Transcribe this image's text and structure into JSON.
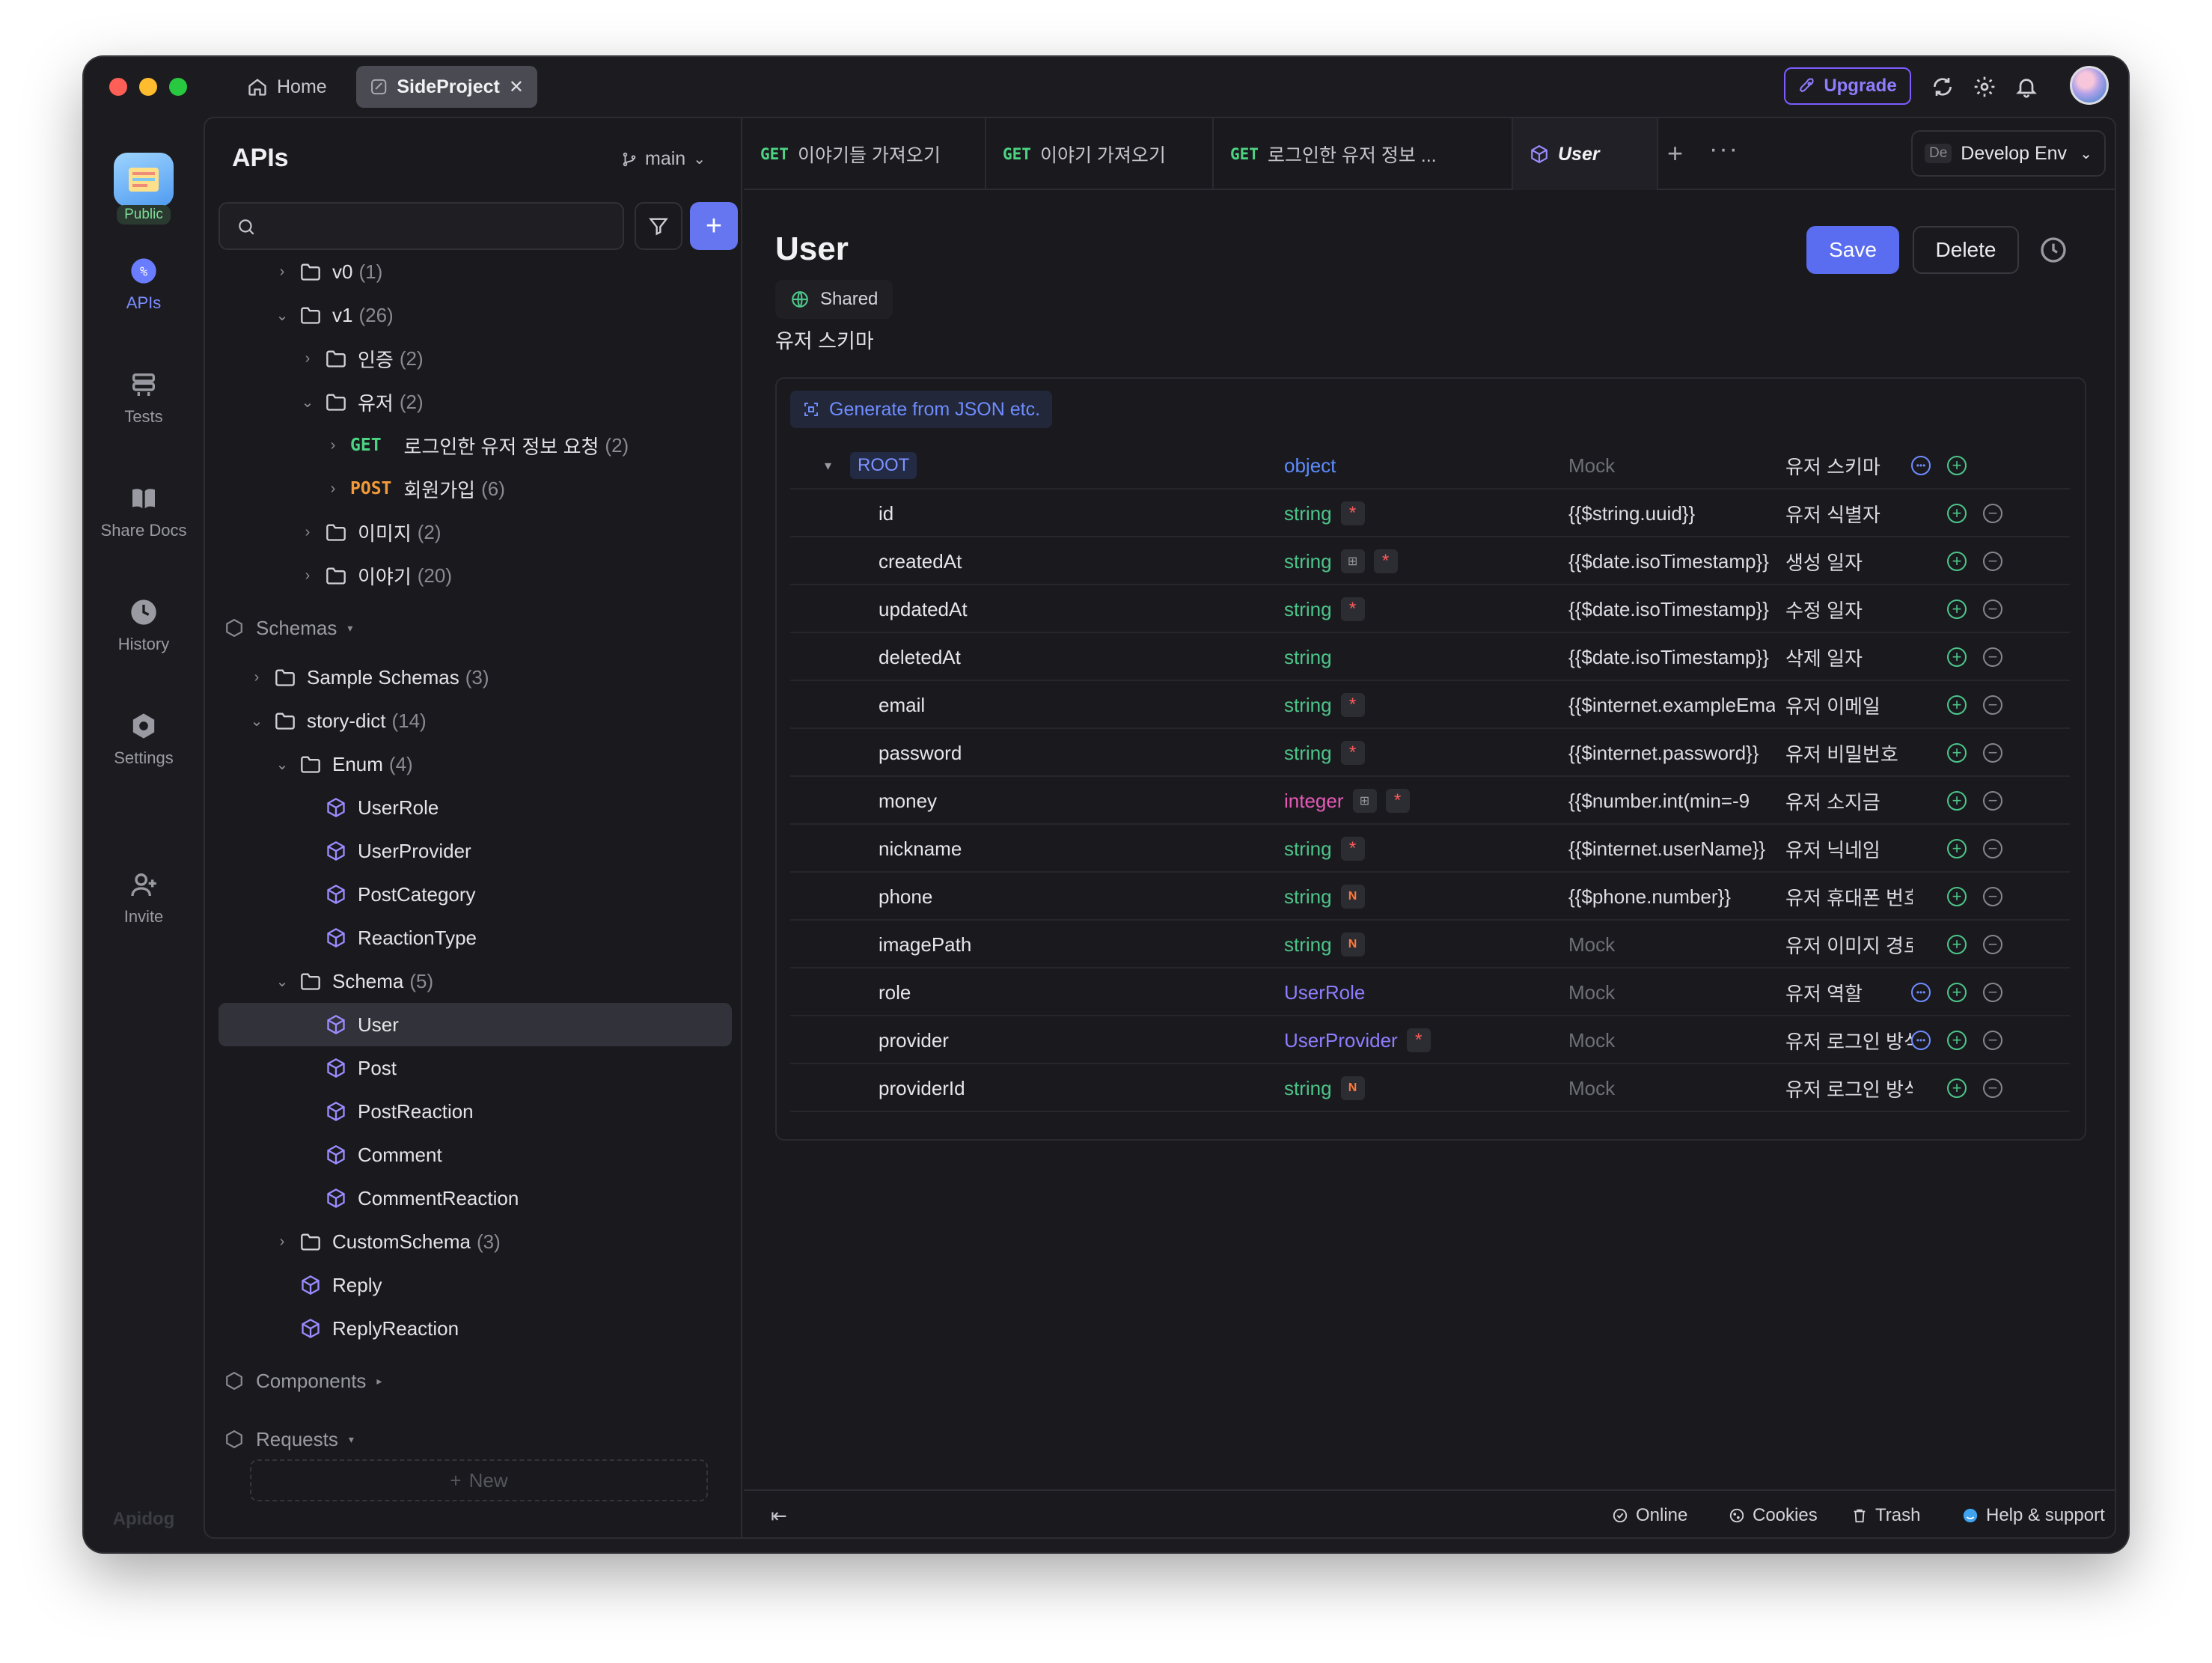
{
  "titlebar": {
    "home_label": "Home",
    "project_tab_label": "SideProject",
    "upgrade_label": "Upgrade"
  },
  "rail": {
    "public_badge": "Public",
    "items": [
      {
        "label": "APIs",
        "icon": "apis-icon",
        "active": true
      },
      {
        "label": "Tests",
        "icon": "tests-icon",
        "active": false
      },
      {
        "label": "Share Docs",
        "icon": "share-docs-icon",
        "active": false
      },
      {
        "label": "History",
        "icon": "history-icon",
        "active": false
      },
      {
        "label": "Settings",
        "icon": "settings-icon",
        "active": false
      },
      {
        "label": "Invite",
        "icon": "invite-icon",
        "active": false
      }
    ],
    "brand": "Apidog"
  },
  "sidebar": {
    "title": "APIs",
    "branch": "main",
    "tree": [
      {
        "kind": "folder",
        "label": "v0",
        "count": "(1)",
        "depth": 2,
        "chevron": "›"
      },
      {
        "kind": "folder",
        "label": "v1",
        "count": "(26)",
        "depth": 2,
        "chevron": "⌄"
      },
      {
        "kind": "folder",
        "label": "인증",
        "count": "(2)",
        "depth": 3,
        "chevron": "›"
      },
      {
        "kind": "folder",
        "label": "유저",
        "count": "(2)",
        "depth": 3,
        "chevron": "⌄"
      },
      {
        "kind": "endpoint",
        "method": "GET",
        "label": "로그인한 유저 정보 요청",
        "count": "(2)",
        "depth": 4,
        "chevron": "›"
      },
      {
        "kind": "endpoint",
        "method": "POST",
        "label": "회원가입",
        "count": "(6)",
        "depth": 4,
        "chevron": "›"
      },
      {
        "kind": "folder",
        "label": "이미지",
        "count": "(2)",
        "depth": 3,
        "chevron": "›"
      },
      {
        "kind": "folder",
        "label": "이야기",
        "count": "(20)",
        "depth": 3,
        "chevron": "›"
      },
      {
        "kind": "section",
        "label": "Schemas",
        "depth": 0
      },
      {
        "kind": "folder",
        "label": "Sample Schemas",
        "count": "(3)",
        "depth": 1,
        "chevron": "›"
      },
      {
        "kind": "folder",
        "label": "story-dict",
        "count": "(14)",
        "depth": 1,
        "chevron": "⌄"
      },
      {
        "kind": "folder",
        "label": "Enum",
        "count": "(4)",
        "depth": 2,
        "chevron": "⌄"
      },
      {
        "kind": "schema",
        "label": "UserRole",
        "depth": 3
      },
      {
        "kind": "schema",
        "label": "UserProvider",
        "depth": 3
      },
      {
        "kind": "schema",
        "label": "PostCategory",
        "depth": 3
      },
      {
        "kind": "schema",
        "label": "ReactionType",
        "depth": 3
      },
      {
        "kind": "folder",
        "label": "Schema",
        "count": "(5)",
        "depth": 2,
        "chevron": "⌄"
      },
      {
        "kind": "schema",
        "label": "User",
        "depth": 3,
        "selected": true
      },
      {
        "kind": "schema",
        "label": "Post",
        "depth": 3
      },
      {
        "kind": "schema",
        "label": "PostReaction",
        "depth": 3
      },
      {
        "kind": "schema",
        "label": "Comment",
        "depth": 3
      },
      {
        "kind": "schema",
        "label": "CommentReaction",
        "depth": 3
      },
      {
        "kind": "folder",
        "label": "CustomSchema",
        "count": "(3)",
        "depth": 2,
        "chevron": "›"
      },
      {
        "kind": "schema",
        "label": "Reply",
        "depth": 2
      },
      {
        "kind": "schema",
        "label": "ReplyReaction",
        "depth": 2
      },
      {
        "kind": "section",
        "label": "Components",
        "depth": 0
      },
      {
        "kind": "section",
        "label": "Requests",
        "depth": 0
      }
    ],
    "new_label": "New"
  },
  "tabs": [
    {
      "method": "GET",
      "label": "이야기들 가져오기"
    },
    {
      "method": "GET",
      "label": "이야기 가져오기"
    },
    {
      "method": "GET",
      "label": "로그인한 유저 정보 ..."
    },
    {
      "method": "",
      "label": "User",
      "active": true
    }
  ],
  "env": {
    "badge": "De",
    "label": "Develop Env"
  },
  "schema": {
    "title": "User",
    "save_label": "Save",
    "delete_label": "Delete",
    "shared_label": "Shared",
    "description": "유저 스키마",
    "generate_label": "Generate from JSON etc.",
    "root": {
      "name": "ROOT",
      "type": "object",
      "mock": "Mock",
      "desc": "유저 스키마"
    },
    "fields": [
      {
        "name": "id",
        "type": "string",
        "type_kind": "string",
        "required": true,
        "nullable": false,
        "format": false,
        "mock": "{{$string.uuid}}",
        "mock_placeholder": false,
        "desc": "유저 식별자",
        "more": false
      },
      {
        "name": "createdAt",
        "type": "string",
        "type_kind": "string",
        "required": true,
        "nullable": false,
        "format": true,
        "mock": "{{$date.isoTimestamp}}",
        "mock_placeholder": false,
        "desc": "생성 일자",
        "more": false
      },
      {
        "name": "updatedAt",
        "type": "string",
        "type_kind": "string",
        "required": true,
        "nullable": false,
        "format": false,
        "mock": "{{$date.isoTimestamp}}",
        "mock_placeholder": false,
        "desc": "수정 일자",
        "more": false
      },
      {
        "name": "deletedAt",
        "type": "string",
        "type_kind": "string",
        "required": false,
        "nullable": false,
        "format": false,
        "mock": "{{$date.isoTimestamp}}",
        "mock_placeholder": false,
        "desc": "삭제 일자",
        "more": false
      },
      {
        "name": "email",
        "type": "string",
        "type_kind": "string",
        "required": true,
        "nullable": false,
        "format": false,
        "mock": "{{$internet.exampleEmail}}",
        "mock_placeholder": false,
        "desc": "유저 이메일",
        "more": false
      },
      {
        "name": "password",
        "type": "string",
        "type_kind": "string",
        "required": true,
        "nullable": false,
        "format": false,
        "mock": "{{$internet.password}}",
        "mock_placeholder": false,
        "desc": "유저 비밀번호",
        "more": false
      },
      {
        "name": "money",
        "type": "integer",
        "type_kind": "integer",
        "required": true,
        "nullable": false,
        "format": true,
        "mock": "{{$number.int(min=-9",
        "mock_placeholder": false,
        "desc": "유저 소지금",
        "more": false
      },
      {
        "name": "nickname",
        "type": "string",
        "type_kind": "string",
        "required": true,
        "nullable": false,
        "format": false,
        "mock": "{{$internet.userName}}",
        "mock_placeholder": false,
        "desc": "유저 닉네임",
        "more": false
      },
      {
        "name": "phone",
        "type": "string",
        "type_kind": "string",
        "required": false,
        "nullable": true,
        "format": false,
        "mock": "{{$phone.number}}",
        "mock_placeholder": false,
        "desc": "유저 휴대폰 번호",
        "more": false
      },
      {
        "name": "imagePath",
        "type": "string",
        "type_kind": "string",
        "required": false,
        "nullable": true,
        "format": false,
        "mock": "Mock",
        "mock_placeholder": true,
        "desc": "유저 이미지 경로",
        "more": false
      },
      {
        "name": "role",
        "type": "UserRole",
        "type_kind": "ref",
        "required": false,
        "nullable": false,
        "format": false,
        "mock": "Mock",
        "mock_placeholder": true,
        "desc": "유저 역할",
        "more": true
      },
      {
        "name": "provider",
        "type": "UserProvider",
        "type_kind": "ref",
        "required": true,
        "nullable": false,
        "format": false,
        "mock": "Mock",
        "mock_placeholder": true,
        "desc": "유저 로그인 방식",
        "more": true
      },
      {
        "name": "providerId",
        "type": "string",
        "type_kind": "string",
        "required": false,
        "nullable": true,
        "format": false,
        "mock": "Mock",
        "mock_placeholder": true,
        "desc": "유저 로그인 방식 식",
        "more": false
      }
    ]
  },
  "statusbar": {
    "online_label": "Online",
    "cookies_label": "Cookies",
    "trash_label": "Trash",
    "help_label": "Help & support"
  },
  "colors": {
    "accent": "#5a6cf0",
    "get": "#4cd483",
    "post": "#f39a3a",
    "string_type": "#4cc58a",
    "integer_type": "#e659b8",
    "ref_type": "#8f7dff"
  }
}
